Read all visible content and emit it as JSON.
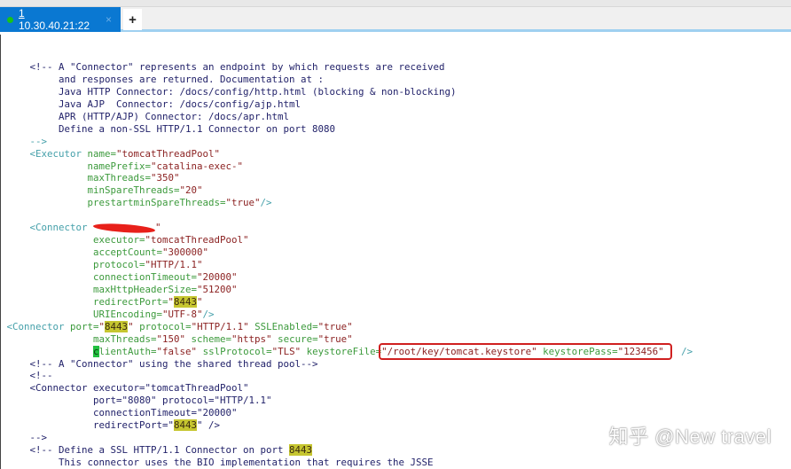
{
  "tab": {
    "index": "1",
    "title": "10.30.40.21:22",
    "close": "×",
    "new_tab": "+"
  },
  "watermark": "知乎 @New travel",
  "colors": {
    "tab": "#0a78d2",
    "highlight": "#c6c630",
    "box": "#d02020"
  },
  "lines": [
    [
      [
        "c",
        "     <!-- A \"Connector\" represents an endpoint by which requests are received"
      ]
    ],
    [
      [
        "c",
        "          and responses are returned. Documentation at :"
      ]
    ],
    [
      [
        "c",
        "          Java HTTP Connector: /docs/config/http.html (blocking & non-blocking)"
      ]
    ],
    [
      [
        "c",
        "          Java AJP  Connector: /docs/config/ajp.html"
      ]
    ],
    [
      [
        "c",
        "          APR (HTTP/AJP) Connector: /docs/apr.html"
      ]
    ],
    [
      [
        "c",
        "          Define a non-SSL HTTP/1.1 Connector on port 8080"
      ]
    ],
    [
      [
        "t",
        "     -->"
      ]
    ],
    [
      [
        "t",
        "     <Executor "
      ],
      [
        "a",
        "name="
      ],
      [
        "v",
        "\"tomcatThreadPool\""
      ]
    ],
    [
      [
        "a",
        "               namePrefix="
      ],
      [
        "v",
        "\"catalina-exec-\""
      ]
    ],
    [
      [
        "a",
        "               maxThreads="
      ],
      [
        "v",
        "\"350\""
      ]
    ],
    [
      [
        "a",
        "               minSpareThreads="
      ],
      [
        "v",
        "\"20\""
      ]
    ],
    [
      [
        "a",
        "               prestartminSpareThreads="
      ],
      [
        "v",
        "\"true\""
      ],
      [
        "t",
        "/>"
      ]
    ],
    [],
    [
      [
        "t",
        "     <Connector "
      ],
      [
        "redact",
        ""
      ],
      [
        "v",
        "\""
      ]
    ],
    [
      [
        "a",
        "                executor="
      ],
      [
        "v",
        "\"tomcatThreadPool\""
      ]
    ],
    [
      [
        "a",
        "                acceptCount="
      ],
      [
        "v",
        "\"300000\""
      ]
    ],
    [
      [
        "a",
        "                protocol="
      ],
      [
        "v",
        "\"HTTP/1.1\""
      ]
    ],
    [
      [
        "a",
        "                connectionTimeout="
      ],
      [
        "v",
        "\"20000\""
      ]
    ],
    [
      [
        "a",
        "                maxHttpHeaderSize="
      ],
      [
        "v",
        "\"51200\""
      ]
    ],
    [
      [
        "a",
        "                redirectPort="
      ],
      [
        "v",
        "\""
      ],
      [
        "h",
        "8443"
      ],
      [
        "v",
        "\""
      ]
    ],
    [
      [
        "a",
        "                URIEncoding="
      ],
      [
        "v",
        "\"UTF-8\""
      ],
      [
        "t",
        "/>"
      ]
    ],
    [
      [
        "t",
        " <Connector "
      ],
      [
        "a",
        "port="
      ],
      [
        "v",
        "\""
      ],
      [
        "h",
        "8443"
      ],
      [
        "v",
        "\" "
      ],
      [
        "a",
        "protocol="
      ],
      [
        "v",
        "\"HTTP/1.1\" "
      ],
      [
        "a",
        "SSLEnabled="
      ],
      [
        "v",
        "\"true\""
      ]
    ],
    [
      [
        "a",
        "                maxThreads="
      ],
      [
        "v",
        "\"150\" "
      ],
      [
        "a",
        "scheme="
      ],
      [
        "v",
        "\"https\" "
      ],
      [
        "a",
        "secure="
      ],
      [
        "v",
        "\"true\""
      ]
    ],
    [
      [
        "a",
        "                "
      ],
      [
        "cur",
        "c"
      ],
      [
        "a",
        "lientAuth="
      ],
      [
        "v",
        "\"false\" "
      ],
      [
        "a",
        "sslProtocol="
      ],
      [
        "v",
        "\"TLS\" "
      ],
      [
        "a",
        "keystoreFile="
      ],
      [
        "box",
        [
          [
            "v",
            "\"/root/key/tomcat.keystore\" "
          ],
          [
            "a",
            "keystorePass="
          ],
          [
            "v",
            "\"123456\" "
          ]
        ]
      ],
      [
        "t",
        "  />"
      ]
    ],
    [
      [
        "c",
        "     <!-- A \"Connector\" using the shared thread pool-->"
      ]
    ],
    [
      [
        "c",
        "     <!--"
      ]
    ],
    [
      [
        "c",
        "     <Connector executor=\"tomcatThreadPool\""
      ]
    ],
    [
      [
        "c",
        "                port=\"8080\" protocol=\"HTTP/1.1\""
      ]
    ],
    [
      [
        "c",
        "                connectionTimeout=\"20000\""
      ]
    ],
    [
      [
        "c",
        "                redirectPort=\""
      ],
      [
        "h",
        "8443"
      ],
      [
        "c",
        "\" />"
      ]
    ],
    [
      [
        "c",
        "     -->"
      ]
    ],
    [
      [
        "c",
        "     <!-- Define a SSL HTTP/1.1 Connector on port "
      ],
      [
        "h",
        "8443"
      ]
    ],
    [
      [
        "c",
        "          This connector uses the BIO implementation that requires the JSSE"
      ]
    ]
  ]
}
